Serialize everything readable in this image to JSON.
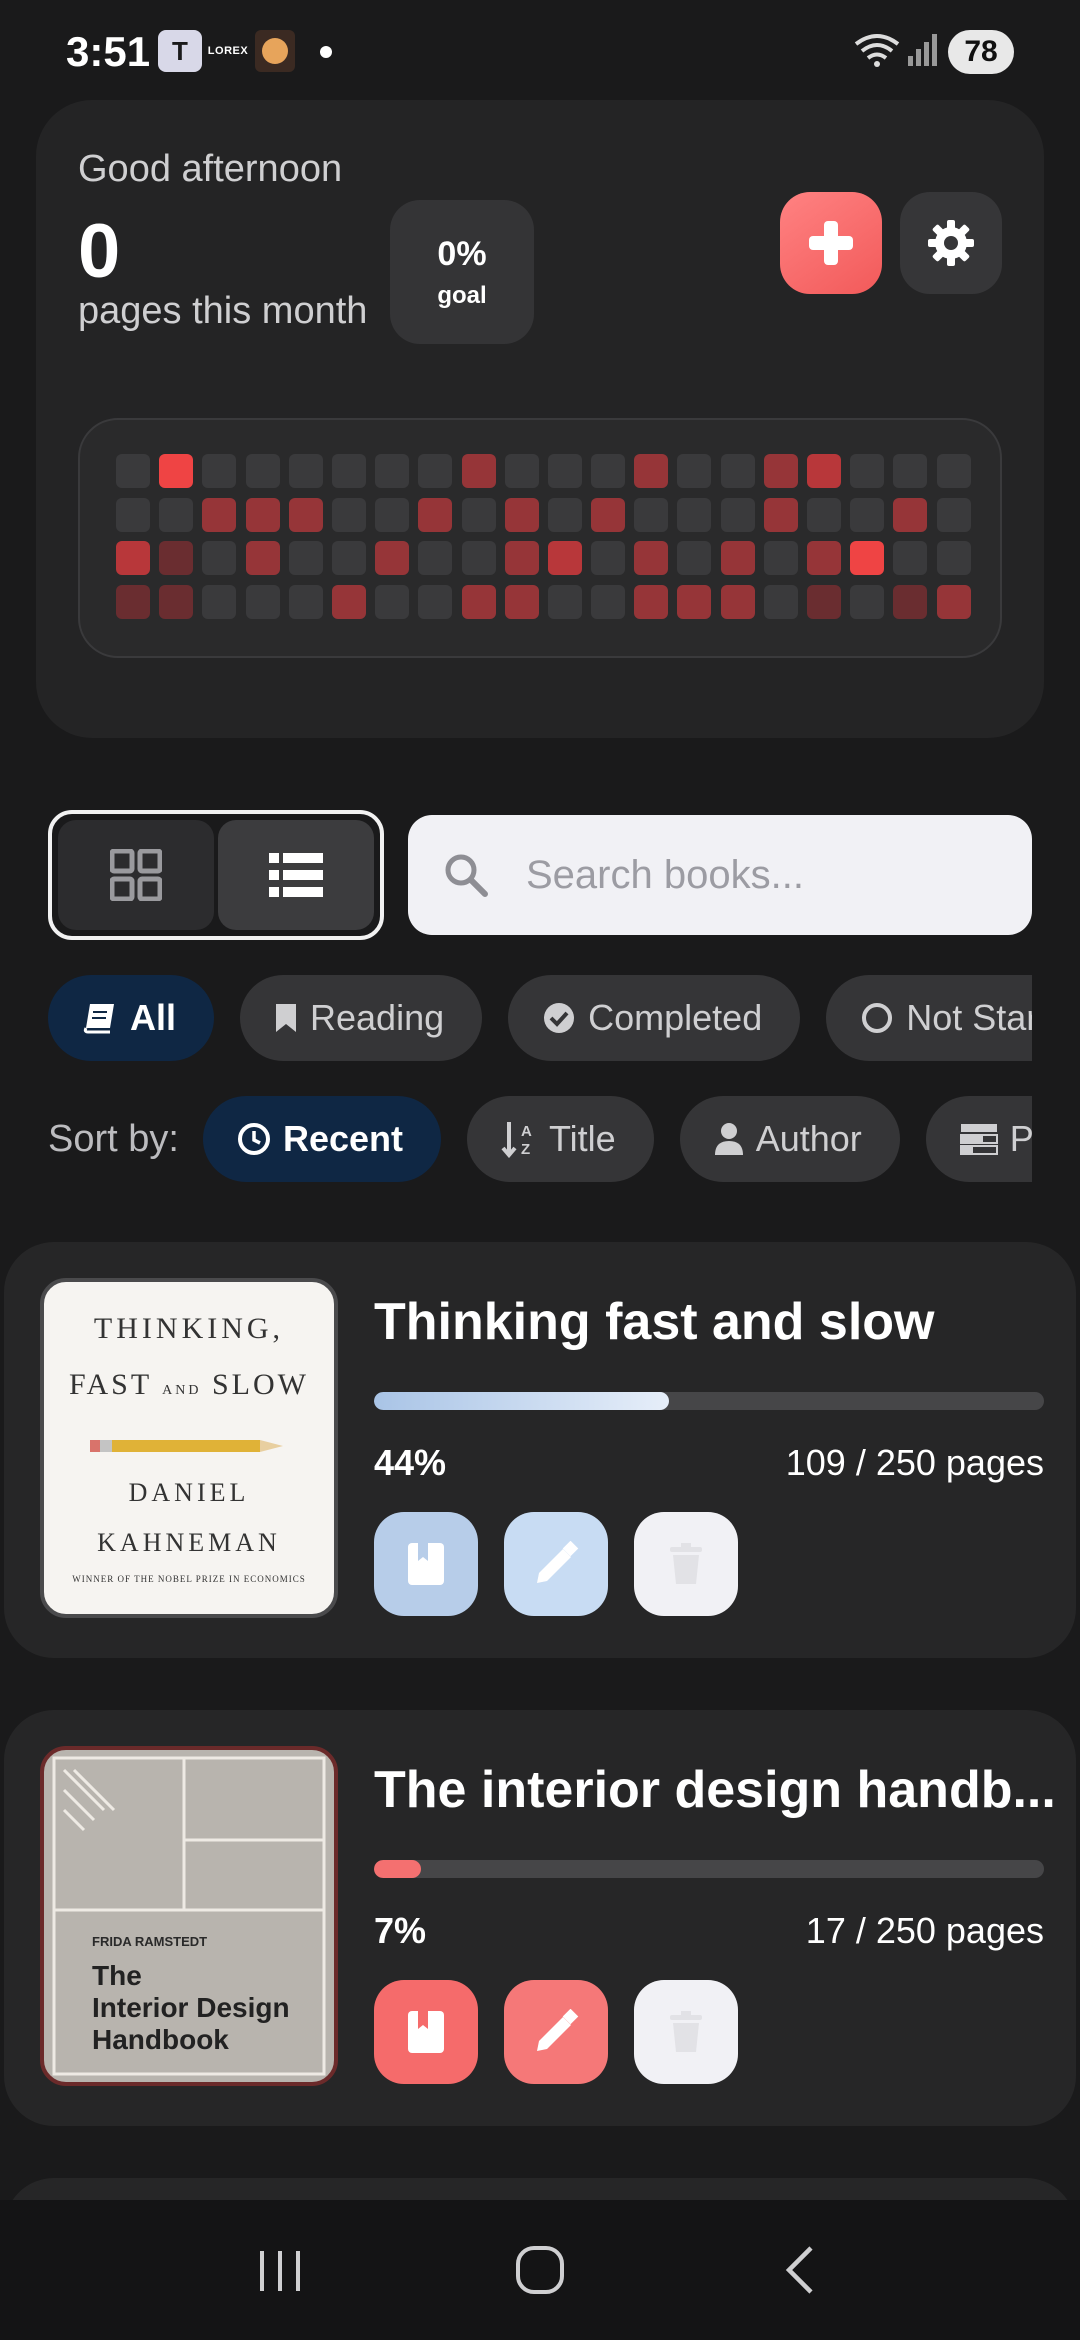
{
  "status_bar": {
    "time": "3:51",
    "teams_icon": "teams-icon",
    "lorex_label": "LOREX",
    "battery": "78"
  },
  "summary": {
    "greeting": "Good afternoon",
    "pages_count": "0",
    "pages_label": "pages this month",
    "goal_value": "0%",
    "goal_label": "goal",
    "add_icon": "plus-icon",
    "settings_icon": "gear-icon",
    "heatmap_levels": [
      [
        0,
        4,
        0,
        0,
        0,
        0,
        0,
        0,
        2,
        0,
        0,
        0,
        2,
        0,
        0,
        2,
        3,
        0,
        0,
        0
      ],
      [
        0,
        0,
        2,
        2,
        2,
        0,
        0,
        2,
        0,
        2,
        0,
        2,
        0,
        0,
        0,
        2,
        0,
        0,
        2,
        0
      ],
      [
        3,
        1,
        0,
        2,
        0,
        0,
        2,
        0,
        0,
        2,
        3,
        0,
        2,
        0,
        2,
        0,
        2,
        4,
        0,
        0
      ],
      [
        1,
        1,
        0,
        0,
        0,
        2,
        0,
        0,
        2,
        2,
        0,
        0,
        2,
        2,
        2,
        0,
        1,
        0,
        1,
        2
      ]
    ]
  },
  "controls": {
    "search_placeholder": "Search books...",
    "filters": [
      "All",
      "Reading",
      "Completed",
      "Not Started"
    ],
    "active_filter": "All",
    "sort_label": "Sort by:",
    "sorts": [
      "Recent",
      "Title",
      "Author",
      "Progress"
    ],
    "active_sort": "Recent"
  },
  "books": [
    {
      "title": "Thinking fast and slow",
      "progress": 0.44,
      "percent": "44%",
      "pages": "109 / 250 pages",
      "cover_lines": [
        "THINKING,",
        "FAST",
        "AND",
        "SLOW",
        "DANIEL",
        "KAHNEMAN",
        "WINNER OF THE NOBEL PRIZE IN ECONOMICS"
      ]
    },
    {
      "title": "The interior design handb...",
      "progress": 0.07,
      "percent": "7%",
      "pages": "17 / 250 pages",
      "cover_lines": [
        "FRIDA RAMSTEDT",
        "The",
        "Interior Design",
        "Handbook"
      ]
    }
  ],
  "colors": {
    "accent_red": "#f25a5a",
    "accent_blue": "#b7cde9",
    "active_chip": "#0f2744",
    "heat_max": "#ef4444"
  }
}
